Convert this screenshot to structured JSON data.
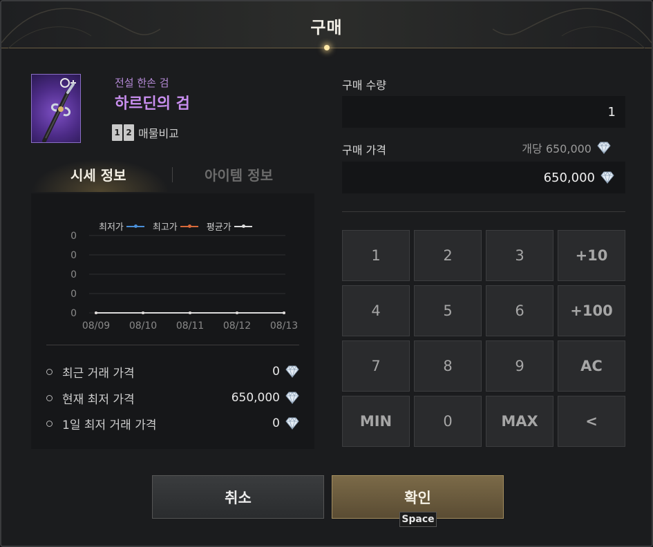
{
  "dialog": {
    "title": "구매"
  },
  "item": {
    "grade": "전설 한손 검",
    "name": "하르딘의 검",
    "compare_icon": [
      "1",
      "2"
    ],
    "compare_label": "매물비교"
  },
  "tabs": [
    {
      "label": "시세 정보",
      "active": true
    },
    {
      "label": "아이템 정보",
      "active": false
    }
  ],
  "chart_data": {
    "type": "line",
    "x": [
      "08/09",
      "08/10",
      "08/11",
      "08/12",
      "08/13"
    ],
    "y_ticks": [
      "0",
      "0",
      "0",
      "0",
      "0"
    ],
    "series": [
      {
        "name": "최저가",
        "color": "#4a8fd8",
        "values": [
          0,
          0,
          0,
          0,
          0
        ]
      },
      {
        "name": "최고가",
        "color": "#d8693a",
        "values": [
          0,
          0,
          0,
          0,
          0
        ]
      },
      {
        "name": "평균가",
        "color": "#dcdcdc",
        "values": [
          0,
          0,
          0,
          0,
          0
        ]
      }
    ],
    "grid": true,
    "legend": "top"
  },
  "stats": [
    {
      "label": "최근 거래 가격",
      "value": "0"
    },
    {
      "label": "현재 최저 가격",
      "value": "650,000"
    },
    {
      "label": "1일 최저 거래 가격",
      "value": "0"
    }
  ],
  "purchase": {
    "quantity_label": "구매 수량",
    "quantity_value": "1",
    "price_label": "구매 가격",
    "unit_price": "개당 650,000",
    "price_value": "650,000"
  },
  "keypad": [
    "1",
    "2",
    "3",
    "+10",
    "4",
    "5",
    "6",
    "+100",
    "7",
    "8",
    "9",
    "AC",
    "MIN",
    "0",
    "MAX",
    "<"
  ],
  "buttons": {
    "cancel": "취소",
    "confirm": "확인",
    "confirm_hotkey": "Space"
  },
  "colors": {
    "accent_gold": "#a38d5e",
    "legendary_purple": "#c98ff0"
  }
}
